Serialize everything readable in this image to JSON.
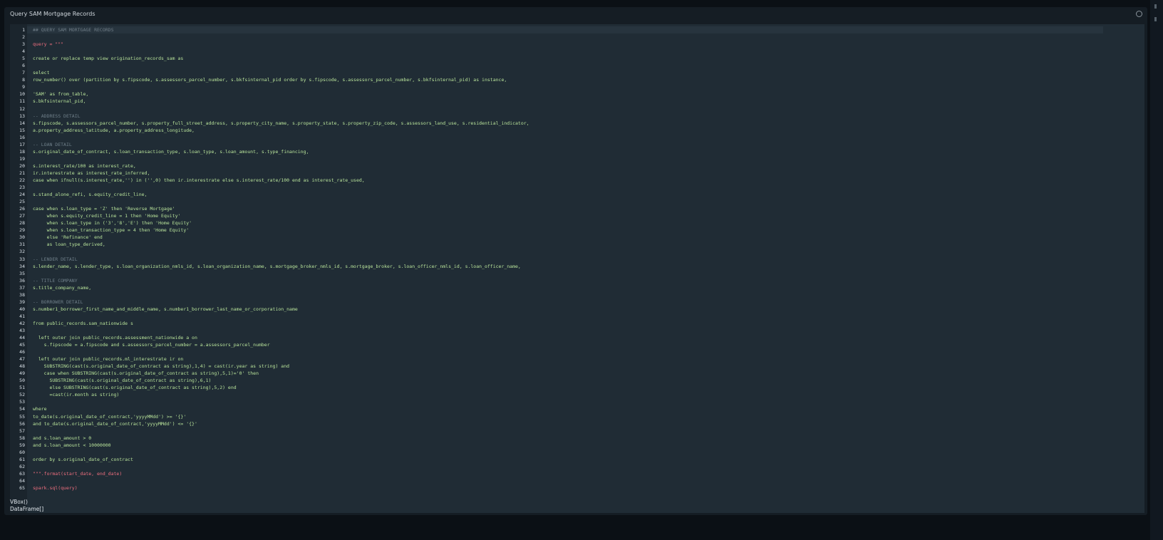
{
  "panel": {
    "title": "Query SAM Mortgage Records"
  },
  "code_lines": [
    {
      "n": "1",
      "text": "## QUERY SAM MORTGAGE RECORDS",
      "kind": "ctitle"
    },
    {
      "n": "2",
      "text": "",
      "kind": "sql"
    },
    {
      "n": "3",
      "text": "query = \"\"\"",
      "kind": "py"
    },
    {
      "n": "4",
      "text": "",
      "kind": "sql"
    },
    {
      "n": "5",
      "text": "create or replace temp view origination_records_sam as",
      "kind": "sql"
    },
    {
      "n": "6",
      "text": "",
      "kind": "sql"
    },
    {
      "n": "7",
      "text": "select",
      "kind": "sql"
    },
    {
      "n": "8",
      "text": "row_number() over (partition by s.fipscode, s.assessors_parcel_number, s.bkfsinternal_pid order by s.fipscode, s.assessors_parcel_number, s.bkfsinternal_pid) as instance,",
      "kind": "sql"
    },
    {
      "n": "9",
      "text": "",
      "kind": "sql"
    },
    {
      "n": "10",
      "text": "'SAM' as from_table,",
      "kind": "sql"
    },
    {
      "n": "11",
      "text": "s.bkfsinternal_pid,",
      "kind": "sql"
    },
    {
      "n": "12",
      "text": "",
      "kind": "sql"
    },
    {
      "n": "13",
      "text": "-- ADDRESS DETAIL",
      "kind": "comment"
    },
    {
      "n": "14",
      "text": "s.fipscode, s.assessors_parcel_number, s.property_full_street_address, s.property_city_name, s.property_state, s.property_zip_code, s.assessors_land_use, s.residential_indicator,",
      "kind": "sql"
    },
    {
      "n": "15",
      "text": "a.property_address_latitude, a.property_address_longitude,",
      "kind": "sql"
    },
    {
      "n": "16",
      "text": "",
      "kind": "sql"
    },
    {
      "n": "17",
      "text": "-- LOAN DETAIL",
      "kind": "comment"
    },
    {
      "n": "18",
      "text": "s.original_date_of_contract, s.loan_transaction_type, s.loan_type, s.loan_amount, s.type_financing,",
      "kind": "sql"
    },
    {
      "n": "19",
      "text": "",
      "kind": "sql"
    },
    {
      "n": "20",
      "text": "s.interest_rate/100 as interest_rate,",
      "kind": "sql"
    },
    {
      "n": "21",
      "text": "ir.interestrate as interest_rate_inferred,",
      "kind": "sql"
    },
    {
      "n": "22",
      "text": "case when ifnull(s.interest_rate,'') in ('',0) then ir.interestrate else s.interest_rate/100 end as interest_rate_used,",
      "kind": "sql"
    },
    {
      "n": "23",
      "text": "",
      "kind": "sql"
    },
    {
      "n": "24",
      "text": "s.stand_alone_refi, s.equity_credit_line,",
      "kind": "sql"
    },
    {
      "n": "25",
      "text": "",
      "kind": "sql"
    },
    {
      "n": "26",
      "text": "case when s.loan_type = 'Z' then 'Reverse Mortgage'",
      "kind": "sql"
    },
    {
      "n": "27",
      "text": "     when s.equity_credit_line = 1 then 'Home Equity'",
      "kind": "sql"
    },
    {
      "n": "28",
      "text": "     when s.loan_type in ('3','8','E') then 'Home Equity'",
      "kind": "sql"
    },
    {
      "n": "29",
      "text": "     when s.loan_transaction_type = 4 then 'Home Equity'",
      "kind": "sql"
    },
    {
      "n": "30",
      "text": "     else 'Refinance' end",
      "kind": "sql"
    },
    {
      "n": "31",
      "text": "     as loan_type_derived,",
      "kind": "sql"
    },
    {
      "n": "32",
      "text": "",
      "kind": "sql"
    },
    {
      "n": "33",
      "text": "-- LENDER DETAIL",
      "kind": "comment"
    },
    {
      "n": "34",
      "text": "s.lender_name, s.lender_type, s.loan_organization_nmls_id, s.loan_organization_name, s.mortgage_broker_nmls_id, s.mortgage_broker, s.loan_officer_nmls_id, s.loan_officer_name,",
      "kind": "sql"
    },
    {
      "n": "35",
      "text": "",
      "kind": "sql"
    },
    {
      "n": "36",
      "text": "-- TITLE COMPANY",
      "kind": "comment"
    },
    {
      "n": "37",
      "text": "s.title_company_name,",
      "kind": "sql"
    },
    {
      "n": "38",
      "text": "",
      "kind": "sql"
    },
    {
      "n": "39",
      "text": "-- BORROWER DETAIL",
      "kind": "comment"
    },
    {
      "n": "40",
      "text": "s.number1_borrower_first_name_and_middle_name, s.number1_borrower_last_name_or_corporation_name",
      "kind": "sql"
    },
    {
      "n": "41",
      "text": "",
      "kind": "sql"
    },
    {
      "n": "42",
      "text": "from public_records.sam_nationwide s",
      "kind": "sql"
    },
    {
      "n": "43",
      "text": "",
      "kind": "sql"
    },
    {
      "n": "44",
      "text": "  left outer join public_records.assessment_nationwide a on",
      "kind": "sql"
    },
    {
      "n": "45",
      "text": "    s.fipscode = a.fipscode and s.assessors_parcel_number = a.assessors_parcel_number",
      "kind": "sql"
    },
    {
      "n": "46",
      "text": "",
      "kind": "sql"
    },
    {
      "n": "47",
      "text": "  left outer join public_records.ml_interestrate ir on",
      "kind": "sql"
    },
    {
      "n": "48",
      "text": "    SUBSTRING(cast(s.original_date_of_contract as string),1,4) = cast(ir.year as string) and",
      "kind": "sql"
    },
    {
      "n": "49",
      "text": "    case when SUBSTRING(cast(s.original_date_of_contract as string),5,1)='0' then",
      "kind": "sql"
    },
    {
      "n": "50",
      "text": "      SUBSTRING(cast(s.original_date_of_contract as string),6,1)",
      "kind": "sql"
    },
    {
      "n": "51",
      "text": "      else SUBSTRING(cast(s.original_date_of_contract as string),5,2) end",
      "kind": "sql"
    },
    {
      "n": "52",
      "text": "      =cast(ir.month as string)",
      "kind": "sql"
    },
    {
      "n": "53",
      "text": "",
      "kind": "sql"
    },
    {
      "n": "54",
      "text": "where",
      "kind": "sql"
    },
    {
      "n": "55",
      "text": "to_date(s.original_date_of_contract,'yyyyMMdd') >= '{}'",
      "kind": "sql"
    },
    {
      "n": "56",
      "text": "and to_date(s.original_date_of_contract,'yyyyMMdd') <= '{}'",
      "kind": "sql"
    },
    {
      "n": "57",
      "text": "",
      "kind": "sql"
    },
    {
      "n": "58",
      "text": "and s.loan_amount > 0",
      "kind": "sql"
    },
    {
      "n": "59",
      "text": "and s.loan_amount < 10000000",
      "kind": "sql"
    },
    {
      "n": "60",
      "text": "",
      "kind": "sql"
    },
    {
      "n": "61",
      "text": "order by s.original_date_of_contract",
      "kind": "sql"
    },
    {
      "n": "62",
      "text": "",
      "kind": "sql"
    },
    {
      "n": "63",
      "text": "\"\"\".format(start_date, end_date)",
      "kind": "py"
    },
    {
      "n": "64",
      "text": "",
      "kind": "sql"
    },
    {
      "n": "65",
      "text": "spark.sql(query)",
      "kind": "py"
    }
  ],
  "output": {
    "line1": "VBox()",
    "line2": "DataFrame[]"
  }
}
